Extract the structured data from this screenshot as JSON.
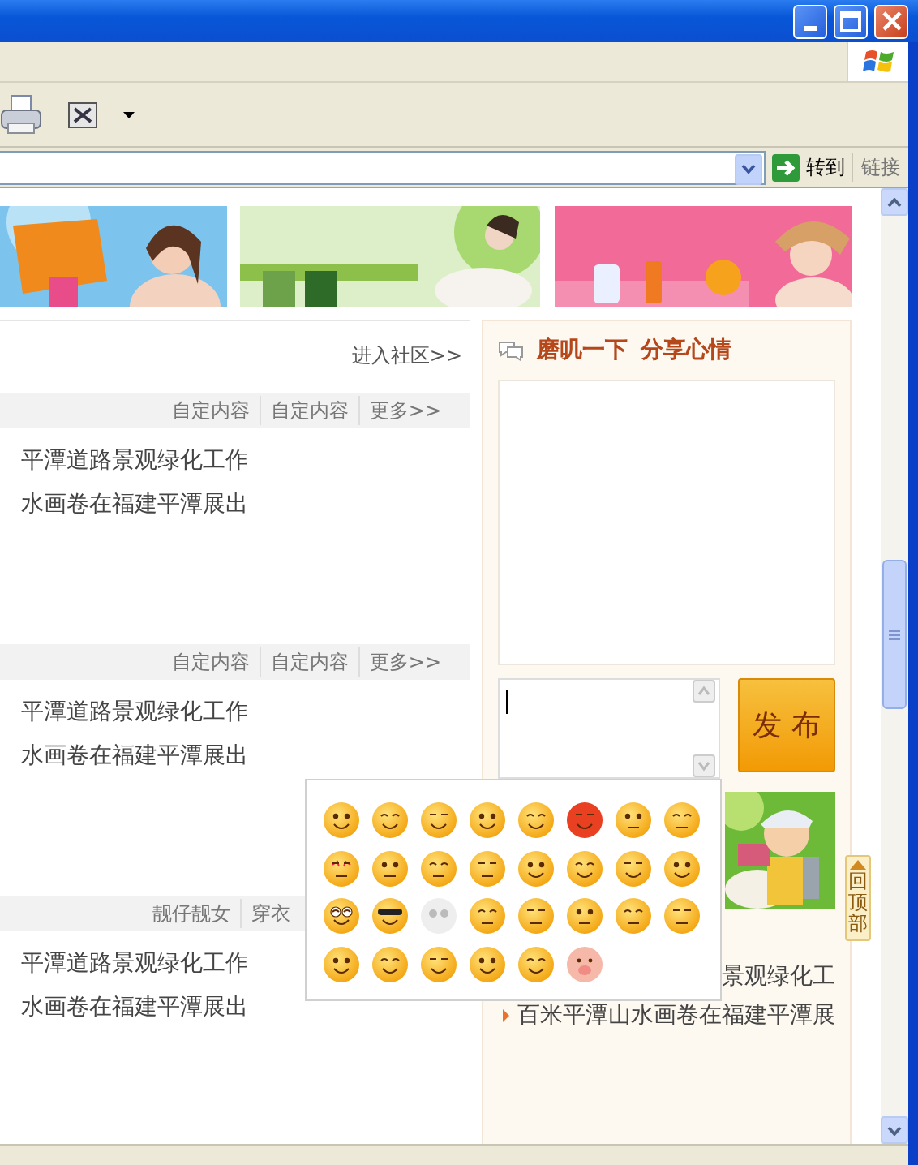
{
  "browser": {
    "go_button": "转到",
    "links_label": "链接"
  },
  "community_link": "进入社区>>",
  "sections": [
    {
      "links": [
        "自定内容",
        "自定内容",
        "更多>>"
      ],
      "items": [
        "平潭道路景观绿化工作",
        "水画卷在福建平潭展出"
      ]
    },
    {
      "links": [
        "自定内容",
        "自定内容",
        "更多>>"
      ],
      "items": [
        "平潭道路景观绿化工作",
        "水画卷在福建平潭展出"
      ]
    },
    {
      "links": [
        "靓仔靓女",
        "穿衣"
      ],
      "items": [
        "平潭道路景观绿化工作",
        "水画卷在福建平潭展出"
      ]
    }
  ],
  "mood_panel": {
    "title_parts": [
      "磨叽一下",
      "分享心情"
    ],
    "post_button": "发 布",
    "items": [
      "景观绿化工",
      "百米平潭山水画卷在福建平潭展"
    ]
  },
  "back_to_top": "回顶部"
}
